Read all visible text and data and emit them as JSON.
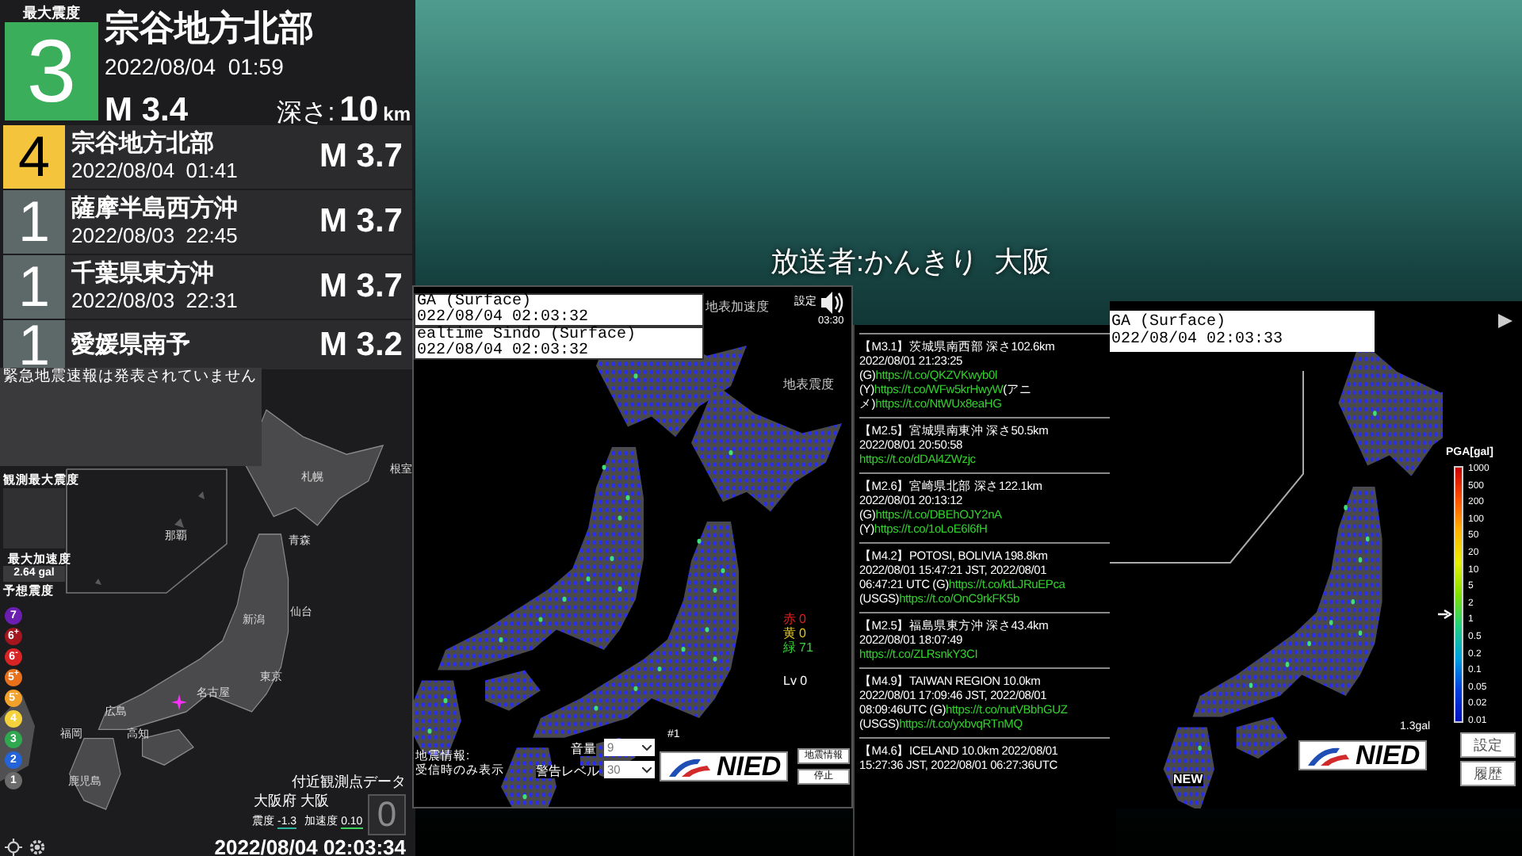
{
  "latest": {
    "label": "最大震度",
    "intensity": "3",
    "color": "#3aae5a",
    "region": "宗谷地方北部",
    "time": "2022/08/04  01:59",
    "magnitude": "M 3.4",
    "depth_label": "深さ:",
    "depth": "10",
    "depth_unit": "km"
  },
  "history": [
    {
      "intensity": "4",
      "color": "#f4c53c",
      "region": "宗谷地方北部",
      "time": "2022/08/04  01:41",
      "magnitude": "M 3.7"
    },
    {
      "intensity": "1",
      "color": "#5d6868",
      "region": "薩摩半島西方沖",
      "time": "2022/08/03  22:45",
      "magnitude": "M 3.7"
    },
    {
      "intensity": "1",
      "color": "#5d6868",
      "region": "千葉県東方沖",
      "time": "2022/08/03  22:31",
      "magnitude": "M 3.7"
    },
    {
      "intensity": "1",
      "color": "#5d6868",
      "region": "愛媛県南予",
      "magnitude": "M 3.2"
    }
  ],
  "eew_banner": "緊急地震速報は発表されていません",
  "map": {
    "max_intensity_label": "観測最大震度",
    "max_accel_label": "最大加速度",
    "max_accel": "2.64 gal",
    "scale_label": "予想震度",
    "scale": [
      {
        "label": "7",
        "color": "#6a1fb0"
      },
      {
        "label": "6$^{+}$",
        "color": "#a3161d"
      },
      {
        "label": "6$^{-}$",
        "color": "#d82424"
      },
      {
        "label": "5$^{+}$",
        "color": "#e8701a"
      },
      {
        "label": "5$^{-}$",
        "color": "#f2a22a"
      },
      {
        "label": "4",
        "color": "#f3d23c"
      },
      {
        "label": "3",
        "color": "#2fa84f"
      },
      {
        "label": "2",
        "color": "#2563d8"
      },
      {
        "label": "1",
        "color": "#6b6b6b"
      }
    ],
    "cities": [
      "札幌",
      "根室",
      "那覇",
      "青森",
      "仙台",
      "新潟",
      "東京",
      "名古屋",
      "広島",
      "高知",
      "福岡",
      "鹿児島"
    ],
    "station": {
      "title": "付近観測点データ",
      "name": "大阪府 大阪",
      "value": "0",
      "intensity_label": "震度",
      "intensity": "-1.3",
      "accel_label": "加速度",
      "accel": "0.10"
    },
    "clock": "2022/08/04 02:03:34"
  },
  "broadcaster": "放送者:かんきり  大阪",
  "kmoni": {
    "titles": [
      {
        "name": "GA (Surface)",
        "time": "022/08/04 02:03:32"
      },
      {
        "name": "ealtime Sindo (Surface)",
        "time": "022/08/04 02:03:32"
      }
    ],
    "map_labels": [
      "地表加速度",
      "地表震度"
    ],
    "settings": "設定",
    "timer": "03:30",
    "counts": [
      {
        "label": "赤",
        "value": "0",
        "color": "#e02020"
      },
      {
        "label": "黄",
        "value": "0",
        "color": "#e6c619"
      },
      {
        "label": "緑",
        "value": "71",
        "color": "#3ad13a"
      }
    ],
    "level": "Lv 0",
    "channel": "#1",
    "quake_info_lines": [
      "地震情報:",
      "受信時のみ表示"
    ],
    "volume_label": "音量",
    "volume": "9",
    "warn_label": "警告レベル",
    "warn": "30",
    "logo": "NIED",
    "buttons": [
      "地震情報",
      "停止"
    ]
  },
  "feed": [
    {
      "lines": [
        [
          {
            "kind": "text",
            "text": "【M3.1】茨城県南西部 深さ102.6km"
          }
        ],
        [
          {
            "kind": "text",
            "text": "2022/08/01 21:23:25"
          }
        ],
        [
          {
            "kind": "text",
            "text": "(G)"
          },
          {
            "kind": "link",
            "text": "https://t.co/QKZVKwyb0l"
          }
        ],
        [
          {
            "kind": "text",
            "text": "(Y)"
          },
          {
            "kind": "link",
            "text": "https://t.co/WFw5krHwyW"
          },
          {
            "kind": "text",
            "text": "(アニ"
          }
        ],
        [
          {
            "kind": "text",
            "text": "メ)"
          },
          {
            "kind": "link",
            "text": "https://t.co/NtWUx8eaHG"
          }
        ]
      ]
    },
    {
      "lines": [
        [
          {
            "kind": "text",
            "text": "【M2.5】宮城県南東沖 深さ50.5km"
          }
        ],
        [
          {
            "kind": "text",
            "text": "2022/08/01 20:50:58"
          }
        ],
        [
          {
            "kind": "link",
            "text": "https://t.co/dDAl4ZWzjc"
          }
        ]
      ]
    },
    {
      "lines": [
        [
          {
            "kind": "text",
            "text": "【M2.6】宮崎県北部 深さ122.1km"
          }
        ],
        [
          {
            "kind": "text",
            "text": "2022/08/01 20:13:12"
          }
        ],
        [
          {
            "kind": "text",
            "text": "(G)"
          },
          {
            "kind": "link",
            "text": "https://t.co/DBEhOJY2nA"
          }
        ],
        [
          {
            "kind": "text",
            "text": "(Y)"
          },
          {
            "kind": "link",
            "text": "https://t.co/1oLoE6l6fH"
          }
        ]
      ]
    },
    {
      "lines": [
        [
          {
            "kind": "text",
            "text": "【M4.2】POTOSI, BOLIVIA 198.8km"
          }
        ],
        [
          {
            "kind": "text",
            "text": "2022/08/01 15:47:21 JST, 2022/08/01"
          }
        ],
        [
          {
            "kind": "text",
            "text": "06:47:21 UTC (G)"
          },
          {
            "kind": "link",
            "text": "https://t.co/ktLJRuEPca"
          }
        ],
        [
          {
            "kind": "text",
            "text": "(USGS)"
          },
          {
            "kind": "link",
            "text": "https://t.co/OnC9rkFK5b"
          }
        ]
      ]
    },
    {
      "lines": [
        [
          {
            "kind": "text",
            "text": "【M2.5】福島県東方沖 深さ43.4km"
          }
        ],
        [
          {
            "kind": "text",
            "text": "2022/08/01 18:07:49"
          }
        ],
        [
          {
            "kind": "link",
            "text": "https://t.co/ZLRsnkY3CI"
          }
        ]
      ]
    },
    {
      "lines": [
        [
          {
            "kind": "text",
            "text": "【M4.9】TAIWAN REGION 10.0km"
          }
        ],
        [
          {
            "kind": "text",
            "text": "2022/08/01 17:09:46 JST, 2022/08/01"
          }
        ],
        [
          {
            "kind": "text",
            "text": "08:09:46UTC (G)"
          },
          {
            "kind": "link",
            "text": "https://t.co/nutVBbhGUZ"
          }
        ],
        [
          {
            "kind": "text",
            "text": "(USGS)"
          },
          {
            "kind": "link",
            "text": "https://t.co/yxbvqRTnMQ"
          }
        ]
      ]
    },
    {
      "lines": [
        [
          {
            "kind": "text",
            "text": "【M4.6】ICELAND 10.0km 2022/08/01"
          }
        ],
        [
          {
            "kind": "text",
            "text": "15:27:36 JST, 2022/08/01 06:27:36UTC"
          }
        ]
      ]
    }
  ],
  "pga": {
    "title": "GA (Surface)",
    "time": "022/08/04 02:03:33",
    "legend_title": "PGA[gal]",
    "legend_ticks": [
      "1000",
      "500",
      "200",
      "100",
      "50",
      "20",
      "10",
      "5",
      "2",
      "1",
      "0.5",
      "0.2",
      "0.1",
      "0.05",
      "0.02",
      "0.01"
    ],
    "reading": "1.3gal",
    "new_label": "NEW",
    "logo": "NIED",
    "buttons": [
      "設定",
      "履歴"
    ]
  }
}
